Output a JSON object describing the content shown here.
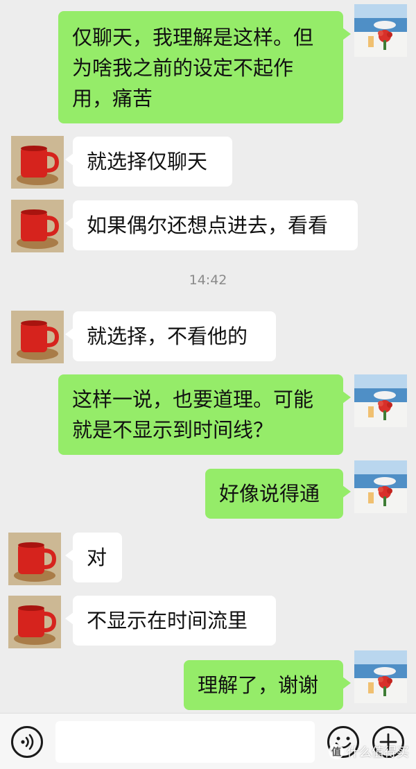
{
  "chat": {
    "messages": [
      {
        "sender": "me",
        "avatar": "sea-balcony-flowers-photo",
        "text": "仅聊天，我理解是这样。但\n为啥我之前的设定不起作\n用，痛苦"
      },
      {
        "sender": "them",
        "avatar": "red-mug-photo",
        "text": "就选择仅聊天"
      },
      {
        "sender": "them",
        "avatar": "red-mug-photo",
        "text": "如果偶尔还想点进去，看看"
      },
      {
        "sender": "them",
        "avatar": "red-mug-photo",
        "text": "就选择，不看他的"
      },
      {
        "sender": "me",
        "avatar": "sea-balcony-flowers-photo",
        "text": "这样一说，也要道理。可能\n就是不显示到时间线？"
      },
      {
        "sender": "me",
        "avatar": "sea-balcony-flowers-photo",
        "text": "好像说得通"
      },
      {
        "sender": "them",
        "avatar": "red-mug-photo",
        "text": "对"
      },
      {
        "sender": "them",
        "avatar": "red-mug-photo",
        "text": "不显示在时间流里"
      },
      {
        "sender": "me",
        "avatar": "sea-balcony-flowers-photo",
        "text": "理解了，谢谢"
      }
    ],
    "timestamp": "14:42"
  },
  "input_bar": {
    "voice_icon": "voice-icon",
    "input_value": "",
    "emoji_icon": "emoji-icon",
    "plus_icon": "plus-icon"
  },
  "watermark": {
    "badge": "值",
    "text": "什么值得买"
  },
  "colors": {
    "background": "#ededed",
    "my_bubble": "#95ec69",
    "their_bubble": "#ffffff",
    "timestamp_text": "#8a8a8a"
  }
}
